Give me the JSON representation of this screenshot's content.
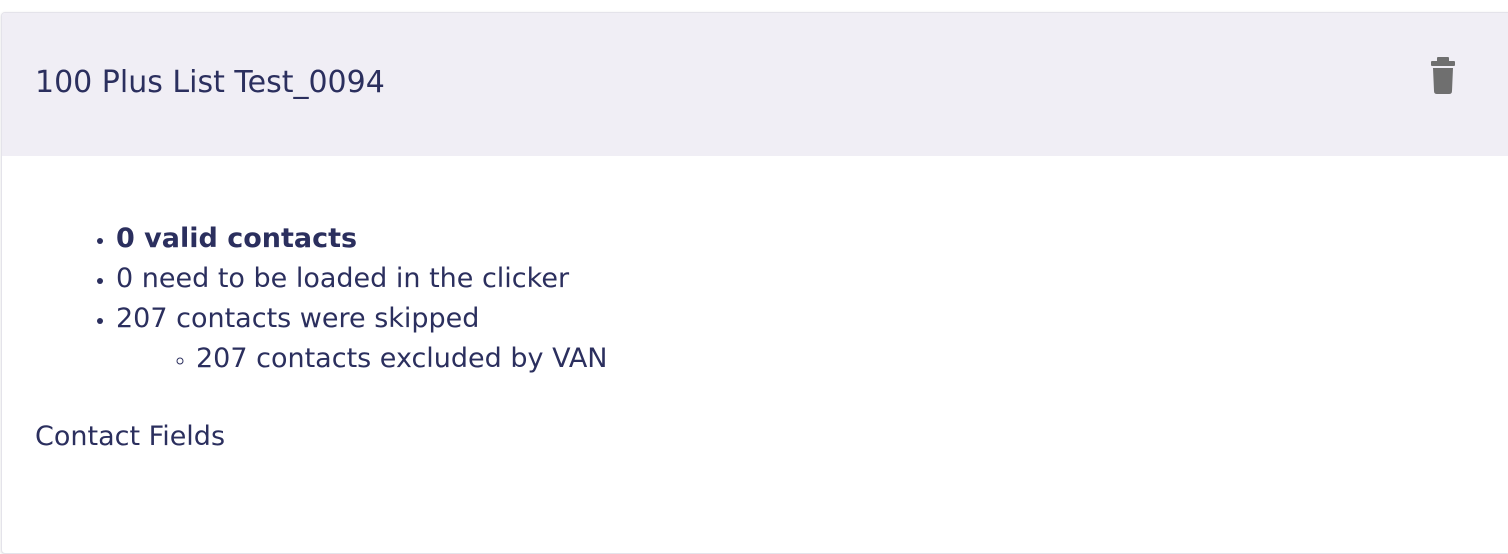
{
  "list_card": {
    "title": "100 Plus List Test_0094",
    "delete_icon": "trash-icon",
    "summary": {
      "valid_contacts": "0 valid contacts",
      "need_loading": "0 need to be loaded in the clicker",
      "skipped": "207 contacts were skipped",
      "skipped_details": [
        "207 contacts excluded by VAN"
      ]
    },
    "contact_fields_label": "Contact Fields"
  },
  "colors": {
    "header_bg": "#f0eef5",
    "text": "#2b2f5e",
    "icon": "#6f6f6f"
  }
}
